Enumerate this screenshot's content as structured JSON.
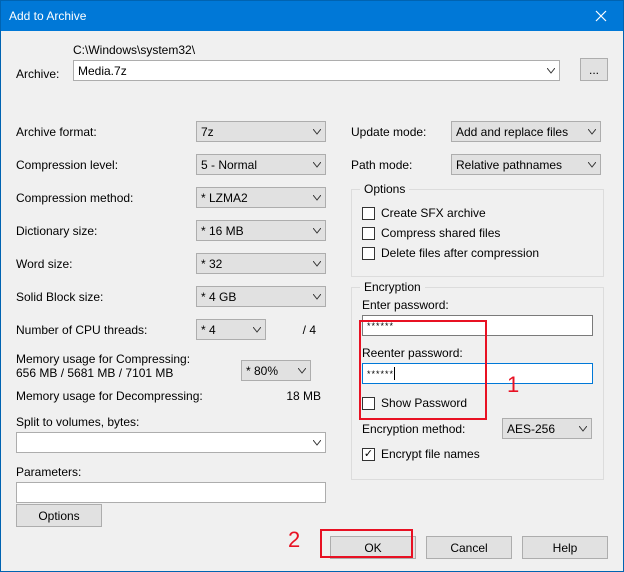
{
  "title": "Add to Archive",
  "archive_label": "Archive:",
  "archive_path": "C:\\Windows\\system32\\",
  "archive_file": "Media.7z",
  "browse": "...",
  "left": {
    "format_label": "Archive format:",
    "format_value": "7z",
    "level_label": "Compression level:",
    "level_value": "5 - Normal",
    "method_label": "Compression method:",
    "method_value": "* LZMA2",
    "dict_label": "Dictionary size:",
    "dict_value": "* 16 MB",
    "word_label": "Word size:",
    "word_value": "* 32",
    "solid_label": "Solid Block size:",
    "solid_value": "* 4 GB",
    "threads_label": "Number of CPU threads:",
    "threads_value": "* 4",
    "threads_frac": "/ 4",
    "mem_comp_label": "Memory usage for Compressing:",
    "mem_comp_value": "656 MB / 5681 MB / 7101 MB",
    "mem_pct_value": "* 80%",
    "mem_decomp_label": "Memory usage for Decompressing:",
    "mem_decomp_value": "18 MB",
    "split_label": "Split to volumes, bytes:",
    "params_label": "Parameters:"
  },
  "right": {
    "update_label": "Update mode:",
    "update_value": "Add and replace files",
    "pathmode_label": "Path mode:",
    "pathmode_value": "Relative pathnames",
    "options_legend": "Options",
    "opt_sfx": "Create SFX archive",
    "opt_shared": "Compress shared files",
    "opt_delete": "Delete files after compression",
    "enc_legend": "Encryption",
    "pw_label": "Enter password:",
    "pw_value": "******",
    "repw_label": "Reenter password:",
    "repw_value": "******",
    "showpw": "Show Password",
    "encmethod_label": "Encryption method:",
    "encmethod_value": "AES-256",
    "encnames": "Encrypt file names"
  },
  "buttons": {
    "options": "Options",
    "ok": "OK",
    "cancel": "Cancel",
    "help": "Help"
  },
  "annotations": {
    "a1": "1",
    "a2": "2"
  }
}
